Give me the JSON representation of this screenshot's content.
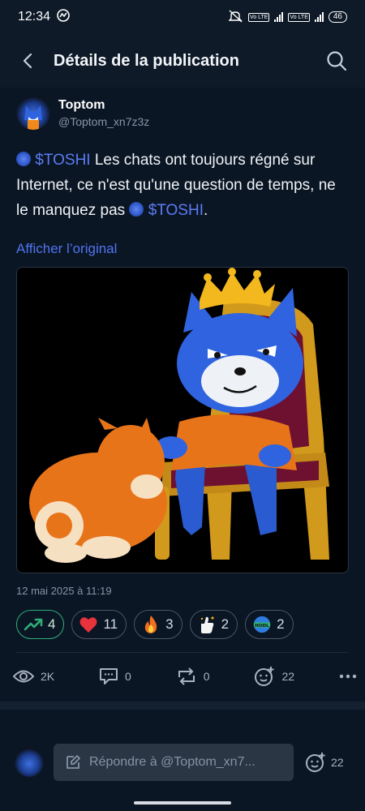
{
  "status": {
    "time": "12:34",
    "battery": "46",
    "volte1": "Vo LTE",
    "volte2": "Vo LTE"
  },
  "header": {
    "title": "Détails de la publication"
  },
  "author": {
    "name": "Toptom",
    "handle": "@Toptom_xn7z3z"
  },
  "post": {
    "cashtag1": "$TOSHI",
    "text1": " Les chats ont toujours régné sur Internet, ce n'est qu'une question de temps, ne le manquez pas ",
    "cashtag2": "$TOSHI",
    "text2": ".",
    "show_original": "Afficher l’original",
    "date": "12 mai 2025 à 11:19"
  },
  "reactions": [
    {
      "icon": "trending-up-icon",
      "count": "4"
    },
    {
      "icon": "heart-icon",
      "count": "11"
    },
    {
      "icon": "fire-icon",
      "count": "3"
    },
    {
      "icon": "thumbs-up-icon",
      "count": "2"
    },
    {
      "icon": "hodl-icon",
      "count": "2"
    }
  ],
  "actions": {
    "views": "2K",
    "comments": "0",
    "reposts": "0",
    "emoji_reactions": "22"
  },
  "reply": {
    "placeholder": "Répondre à @Toptom_xn7...",
    "emoji_count": "22"
  },
  "colors": {
    "accent": "#5b7cf5",
    "background": "#0b1624",
    "active_border": "#2fae79"
  }
}
